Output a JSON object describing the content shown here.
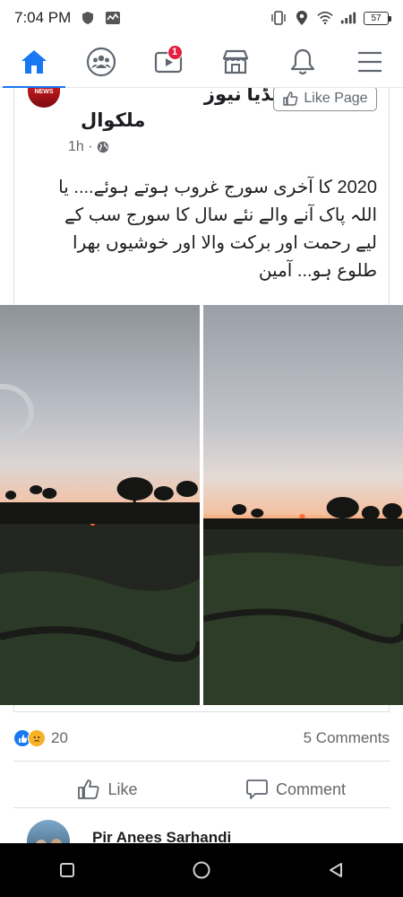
{
  "status_bar": {
    "time": "7:04 PM",
    "battery": "57"
  },
  "nav": {
    "items": [
      {
        "name": "home",
        "active": true
      },
      {
        "name": "groups"
      },
      {
        "name": "watch",
        "badge": "1"
      },
      {
        "name": "marketplace"
      },
      {
        "name": "notifications"
      },
      {
        "name": "menu"
      }
    ]
  },
  "post": {
    "page_name_line1": "سوشل میڈیا نیوز",
    "page_name_line2": "ملکوال",
    "avatar_text": "NEWS",
    "like_page_label": "Like Page",
    "time_ago": "1h ·",
    "text": "2020 کا آخری سورج غروب ہوتے ہوئے.... یا اللہ پاک آنے والے نئے سال کا سورج سب کے لیے رحمت اور برکت والا اور خوشیوں بھرا طلوع ہو... آمین",
    "reaction_count": "20",
    "comments_count": "5 Comments",
    "like_label": "Like",
    "comment_label": "Comment"
  },
  "comment_preview": {
    "name": "Pir Anees Sarhandi"
  },
  "colors": {
    "accent": "#1877f2",
    "badge": "#e41e3f",
    "secondary_text": "#65676b"
  }
}
